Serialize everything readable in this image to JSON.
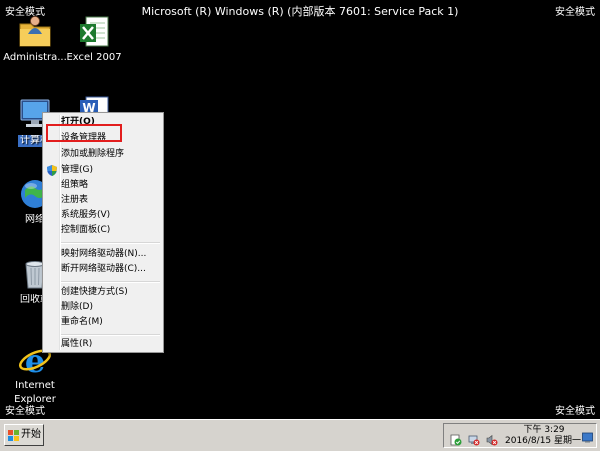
{
  "watermark": {
    "top_left": "安全模式",
    "top_right": "安全模式",
    "bottom_left": "安全模式",
    "bottom_right": "安全模式"
  },
  "title": "Microsoft (R) Windows (R) (内部版本 7601: Service Pack 1)",
  "desktop_icons": [
    {
      "label": "Administra...",
      "icon": "user-folder-icon"
    },
    {
      "label": "Excel 2007",
      "icon": "excel-icon"
    },
    {
      "label": "计算机",
      "icon": "computer-icon"
    },
    {
      "label": "",
      "icon": "word-icon"
    },
    {
      "label": "网络",
      "icon": "network-icon"
    },
    {
      "label": "回收站",
      "icon": "recycle-bin-icon"
    },
    {
      "label": "Internet",
      "label2": "Explorer",
      "icon": "internet-explorer-icon"
    }
  ],
  "context_menu": {
    "items": [
      {
        "label": "打开(O)",
        "bold": true
      },
      {
        "label": "设备管理器",
        "highlighted": true
      },
      {
        "label": "添加或删除程序"
      },
      {
        "label": "管理(G)",
        "icon": "uac-shield-icon"
      },
      {
        "label": "组策略"
      },
      {
        "label": "注册表"
      },
      {
        "label": "系统服务(V)"
      },
      {
        "label": "控制面板(C)"
      },
      {
        "label": "映射网络驱动器(N)..."
      },
      {
        "label": "断开网络驱动器(C)..."
      },
      {
        "label": "创建快捷方式(S)"
      },
      {
        "label": "删除(D)"
      },
      {
        "label": "重命名(M)"
      },
      {
        "label": "属性(R)"
      }
    ]
  },
  "taskbar": {
    "start_label": "开始",
    "tray_icons": [
      "action-center-icon",
      "network-error-icon",
      "volume-mute-icon"
    ],
    "clock_time": "下午 3:29",
    "clock_date": "2016/8/15 星期一"
  },
  "colors": {
    "highlight_box": "#e21d1d",
    "selection": "#3a6fc4",
    "menu_bg": "#f0f0f0",
    "taskbar_bg": "#d6d3ce"
  }
}
